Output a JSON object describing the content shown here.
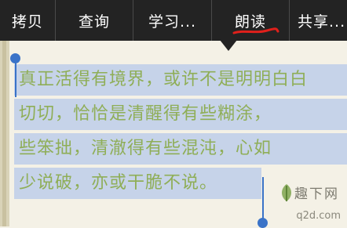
{
  "toolbar": {
    "copy_label": "拷贝",
    "query_label": "查询",
    "study_label": "学习...",
    "read_aloud_label": "朗读",
    "share_label": "共享..."
  },
  "passage": {
    "lines": [
      "真正活得有境界，或许不是明明白白",
      "切切，恰恰是清醒得有些糊涂，",
      "些笨拙，清澈得有些混沌，心如",
      "少说破，亦或干脆不说。"
    ]
  },
  "watermark": {
    "title": "趣下网",
    "url": "q2d.com"
  },
  "colors": {
    "toolbar_bg": "#232323",
    "selection": "#c6d3e9",
    "text": "#8fae57",
    "handle": "#3a73c8",
    "annotation": "#e0201b"
  }
}
